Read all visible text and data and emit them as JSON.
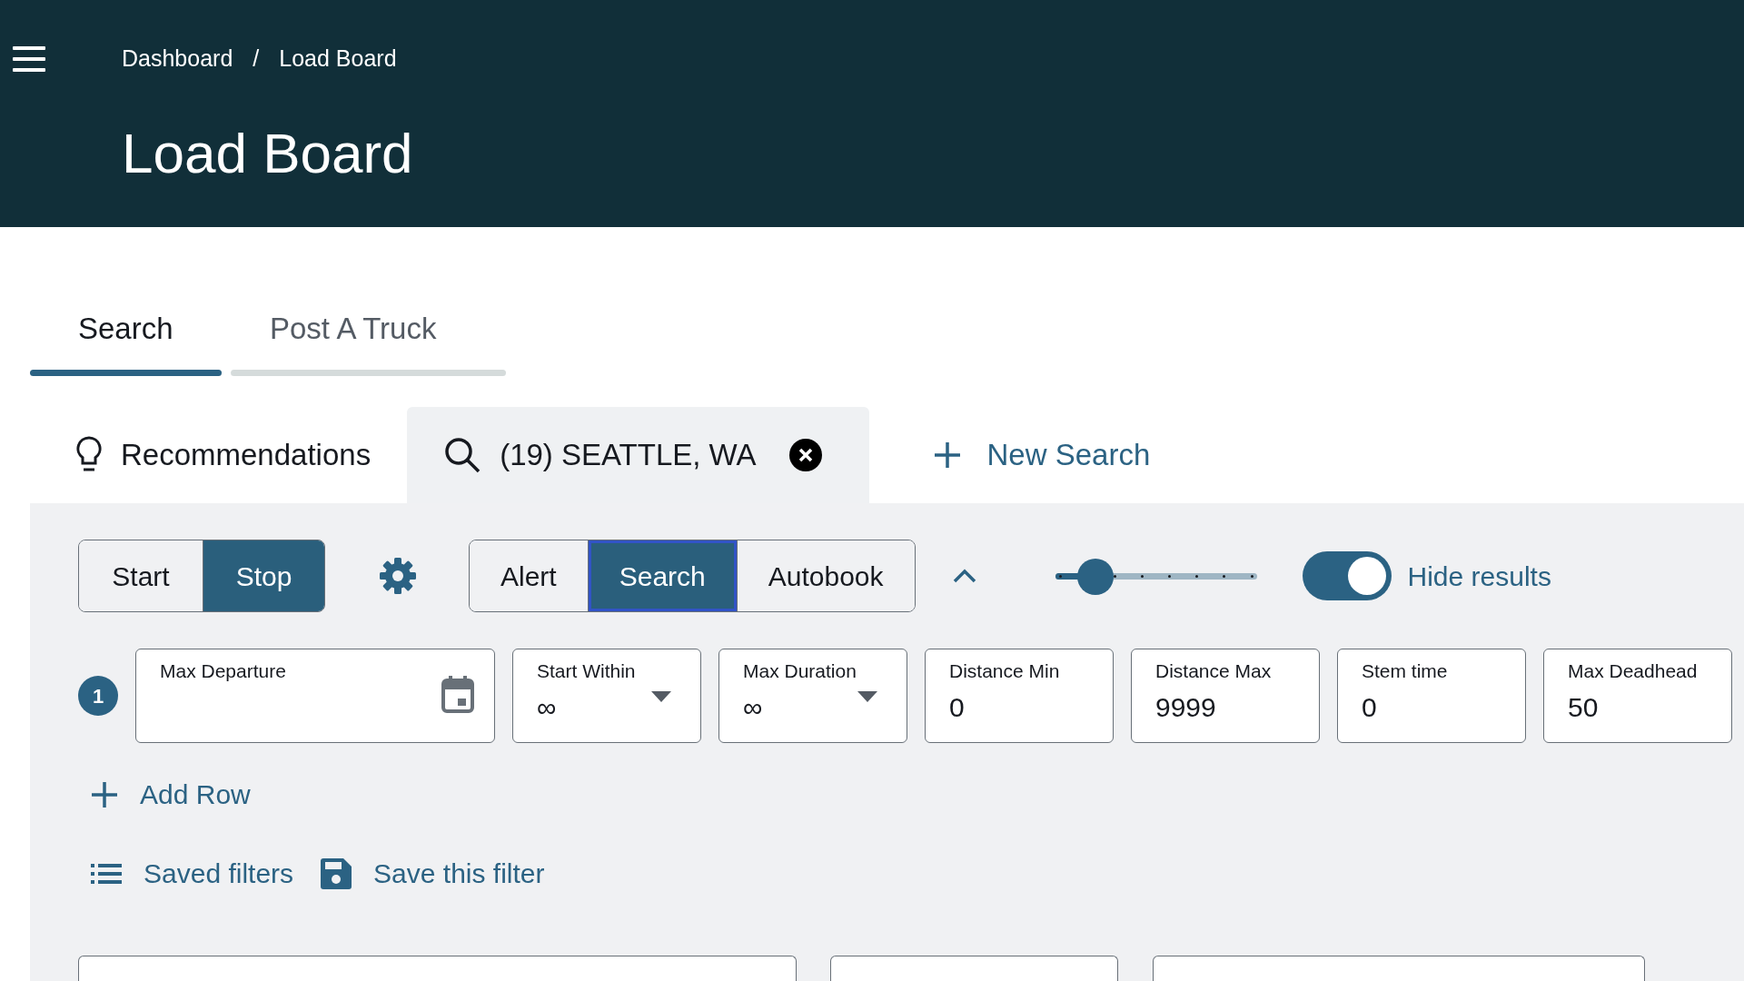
{
  "header": {
    "breadcrumb": [
      {
        "label": "Dashboard"
      },
      {
        "label": "Load Board"
      }
    ],
    "separator": "/",
    "title": "Load Board"
  },
  "tabs": [
    {
      "label": "Search",
      "selected": true
    },
    {
      "label": "Post A Truck",
      "selected": false
    }
  ],
  "search_tabs": [
    {
      "kind": "recommendations",
      "label": "Recommendations",
      "selected": false
    },
    {
      "kind": "search",
      "label": "(19) SEATTLE, WA",
      "selected": true
    }
  ],
  "new_search": "New Search",
  "run_buttons": [
    {
      "label": "Start",
      "selected": false
    },
    {
      "label": "Stop",
      "selected": true
    }
  ],
  "mode_buttons": [
    {
      "label": "Alert",
      "selected": false
    },
    {
      "label": "Search",
      "selected": true
    },
    {
      "label": "Autobook",
      "selected": false
    }
  ],
  "slider": {
    "level": 0.2
  },
  "hide_results": {
    "label": "Hide results",
    "on": true
  },
  "filter_rows": [
    {
      "number": "1",
      "fields": [
        {
          "kind": "date",
          "label": "Max Departure"
        },
        {
          "kind": "dropdown",
          "label": "Start Within",
          "value": "∞"
        },
        {
          "kind": "dropdown",
          "label": "Max Duration",
          "value": "∞"
        },
        {
          "kind": "text",
          "label": "Distance Min",
          "value": "0"
        },
        {
          "kind": "text",
          "label": "Distance Max",
          "value": "9999"
        },
        {
          "kind": "text",
          "label": "Stem time",
          "value": "0"
        },
        {
          "kind": "text",
          "label": "Max Deadhead",
          "value": "50"
        }
      ]
    }
  ],
  "add_row": "Add Row",
  "saved_filters": "Saved filters",
  "save_filter": "Save this filter"
}
